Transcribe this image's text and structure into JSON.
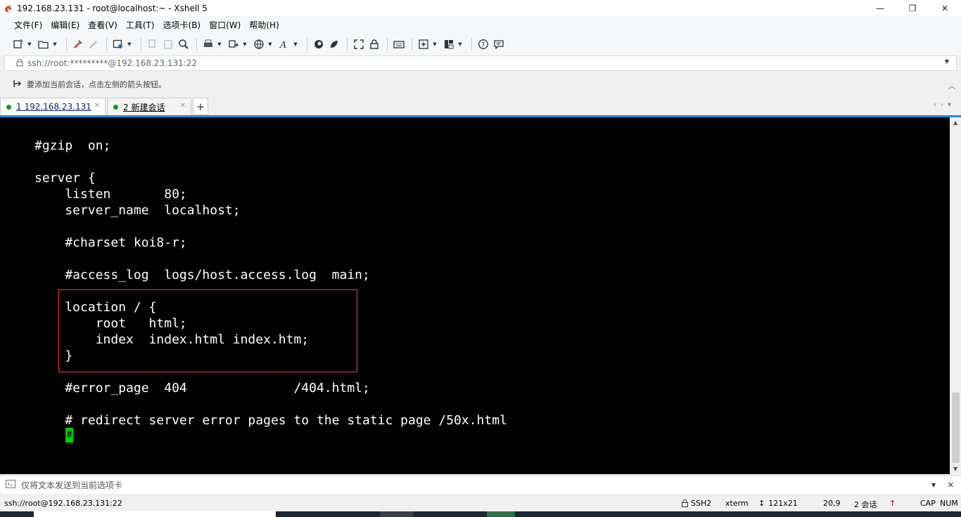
{
  "window": {
    "title": "192.168.23.131 - root@localhost:~ - Xshell 5",
    "minimize": "—",
    "maximize": "❐",
    "close": "✕"
  },
  "menu": {
    "items": [
      "文件(F)",
      "编辑(E)",
      "查看(V)",
      "工具(T)",
      "选项卡(B)",
      "窗口(W)",
      "帮助(H)"
    ]
  },
  "address": {
    "value": "ssh://root:*********@192.168.23.131:22"
  },
  "hint": {
    "text": "要添加当前会话，点击左侧的箭头按钮。"
  },
  "tabs": [
    {
      "label": "1 192.168.23.131",
      "active": true
    },
    {
      "label": "2 新建会话",
      "active": false
    }
  ],
  "terminal": {
    "lines": [
      "#gzip  on;",
      "",
      "server {",
      "    listen       80;",
      "    server_name  localhost;",
      "",
      "    #charset koi8-r;",
      "",
      "    #access_log  logs/host.access.log  main;",
      "",
      "    location / {",
      "        root   html;",
      "        index  index.html index.htm;",
      "    }",
      "",
      "    #error_page  404              /404.html;",
      "",
      "    # redirect server error pages to the static page /50x.html",
      "    #"
    ],
    "cursor_char": "#"
  },
  "compose": {
    "text": "仅将文本发送到当前选项卡"
  },
  "status": {
    "connection": "ssh://root@192.168.23.131:22",
    "protocol": "SSH2",
    "terminal_type": "xterm",
    "size": "121x21",
    "position": "20,9",
    "sessions": "2 会话",
    "caps": "CAP",
    "num": "NUM"
  },
  "colors": {
    "accent": "#1e8ae6",
    "terminal_bg": "#000000",
    "terminal_fg": "#ffffff",
    "cursor": "#00d000",
    "highlight_box": "#ff3b3b",
    "session_dot": "#1a9a1a"
  }
}
